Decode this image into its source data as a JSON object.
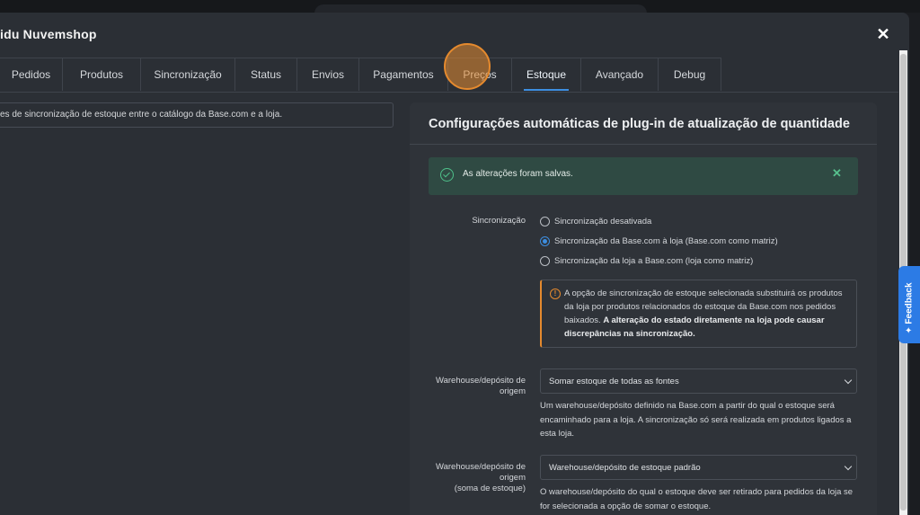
{
  "modal": {
    "title": "idu Nuvemshop",
    "close_icon": "close-icon"
  },
  "tabs": [
    {
      "label": "Pedidos"
    },
    {
      "label": "Produtos"
    },
    {
      "label": "Sincronização"
    },
    {
      "label": "Status"
    },
    {
      "label": "Envios"
    },
    {
      "label": "Pagamentos"
    },
    {
      "label": "Preços"
    },
    {
      "label": "Estoque",
      "active": true
    },
    {
      "label": "Avançado"
    },
    {
      "label": "Debug"
    }
  ],
  "left": {
    "description": "es de sincronização de estoque entre o catálogo da Base.com e a loja."
  },
  "panel": {
    "title": "Configurações automáticas de plug-in de atualização de quantidade",
    "alert": {
      "message": "As alterações foram salvas.",
      "close_icon": "close-icon",
      "icon": "check-circle-icon"
    },
    "sync": {
      "label": "Sincronização",
      "options": [
        {
          "label": "Sincronização desativada",
          "checked": false
        },
        {
          "label": "Sincronização da Base.com à loja (Base.com como matriz)",
          "checked": true
        },
        {
          "label": "Sincronização da loja a Base.com (loja como matriz)",
          "checked": false
        }
      ],
      "warning": {
        "text": "A opção de sincronização de estoque selecionada substituirá os produtos da loja por produtos relacionados do estoque da Base.com nos pedidos baixados. ",
        "bold": "A alteração do estado diretamente na loja pode causar discrepâncias na sincronização."
      }
    },
    "warehouse_origin": {
      "label": "Warehouse/depósito de origem",
      "value": "Somar estoque de todas as fontes",
      "help": "Um warehouse/depósito definido na Base.com a partir do qual o estoque será encaminhado para a loja. A sincronização só será realizada em produtos ligados a esta loja."
    },
    "warehouse_sum": {
      "label_line1": "Warehouse/depósito de origem",
      "label_line2": "(soma de estoque)",
      "value": "Warehouse/depósito de estoque padrão",
      "help": "O warehouse/depósito do qual o estoque deve ser retirado para pedidos da loja se for selecionada a opção de somar o estoque."
    }
  },
  "feedback": {
    "label": "Feedback"
  },
  "colors": {
    "accent": "#3d8ee0",
    "success": "#4fc08a",
    "warning": "#e58a2e",
    "background": "#2b2f35"
  }
}
